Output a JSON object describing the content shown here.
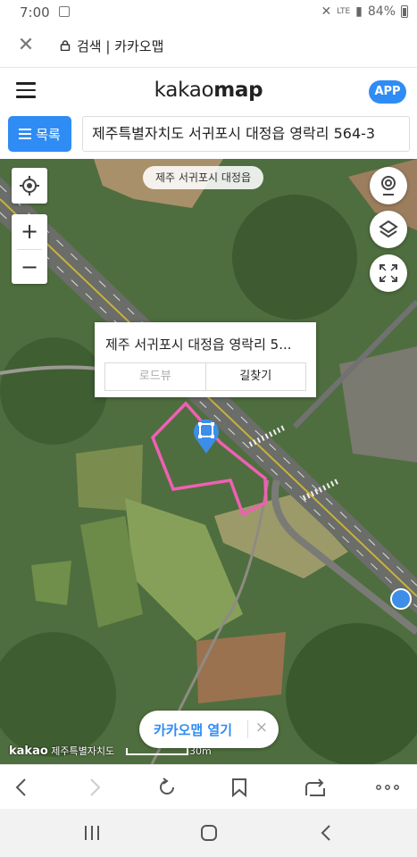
{
  "status_bar": {
    "time": "7:00",
    "battery": "84%",
    "network": "LTE"
  },
  "browser": {
    "page_title": "검색 | 카카오맵"
  },
  "header": {
    "logo_regular": "kakao",
    "logo_bold": "map",
    "app_button": "APP"
  },
  "search": {
    "list_button": "목록",
    "query": "제주특별자치도 서귀포시 대정읍 영락리 564-3"
  },
  "map": {
    "region_chip": "제주 서귀포시 대정읍",
    "zoom_in": "+",
    "zoom_out": "−",
    "popup": {
      "place_name": "제주 서귀포시 대정읍 영락리 5...",
      "roadview_button": "로드뷰",
      "route_button": "길찾기"
    },
    "open_app_banner": {
      "label": "카카오맵 열기",
      "close": "×"
    },
    "copyright": {
      "brand": "kakao",
      "region": "제주특별자치도"
    },
    "scale_label": "30m",
    "parcel_outline_color": "#f05fb4",
    "accent_color": "#2f8cf5"
  },
  "icons": [
    "close-icon",
    "lock-icon",
    "menu-icon",
    "list-icon",
    "location-icon",
    "roadview-icon",
    "layers-icon",
    "fullscreen-icon",
    "map-pin-icon",
    "bus-stop-icon",
    "back-icon",
    "forward-icon",
    "refresh-icon",
    "bookmark-icon",
    "share-icon",
    "more-icon",
    "recent-apps-icon",
    "home-icon",
    "nav-back-icon"
  ]
}
